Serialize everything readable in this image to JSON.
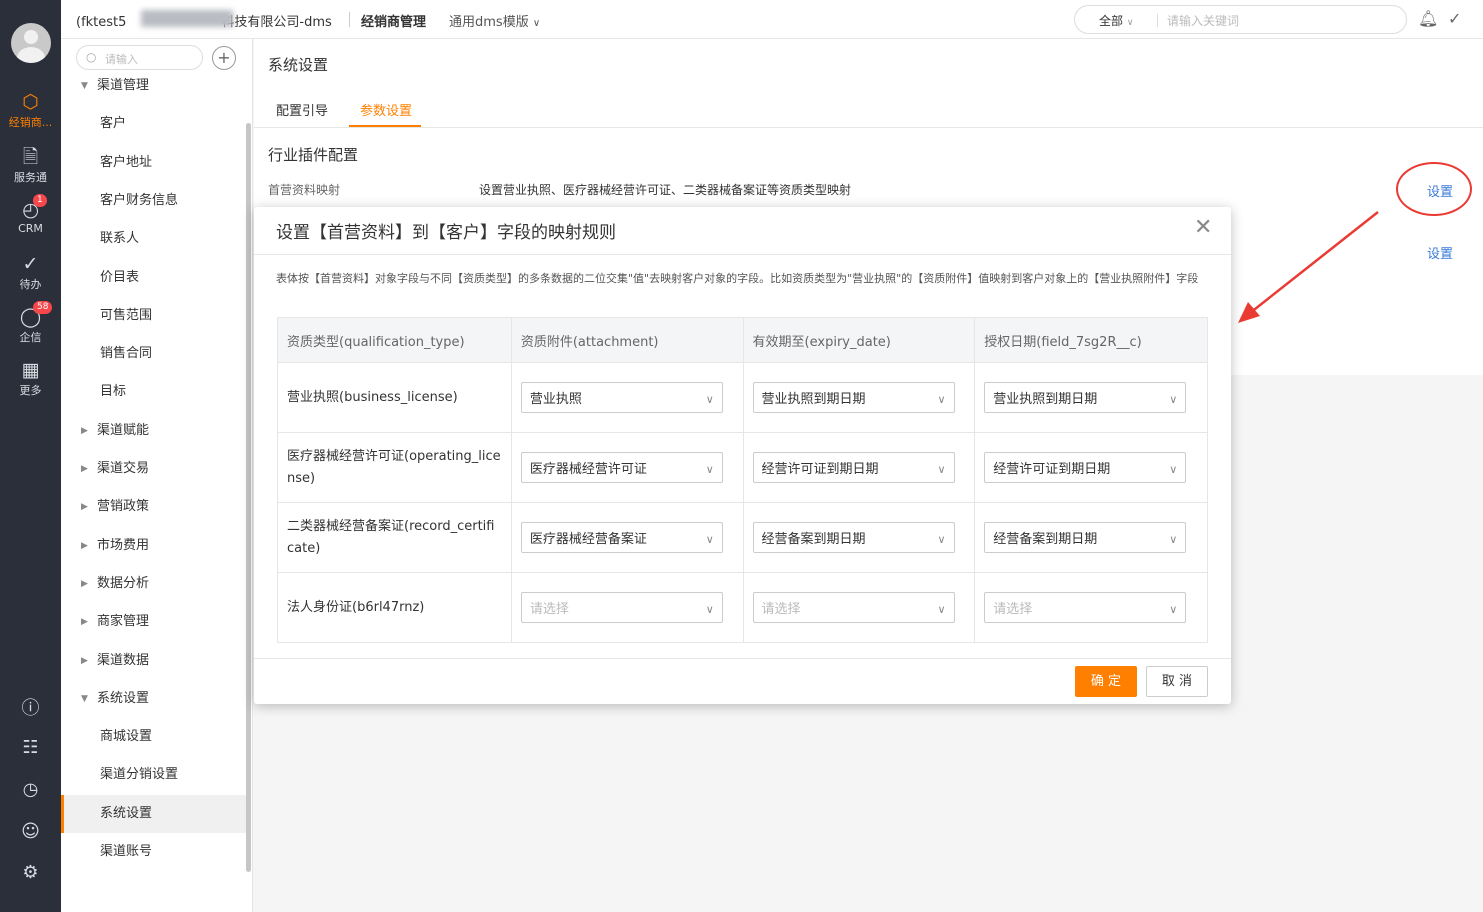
{
  "rail": {
    "items": [
      {
        "label": "经销商...",
        "icon": "cube-icon"
      },
      {
        "label": "服务通",
        "icon": "service-icon"
      },
      {
        "label": "CRM",
        "icon": "crm-icon",
        "badge": "1"
      },
      {
        "label": "待办",
        "icon": "todo-check-icon"
      },
      {
        "label": "企信",
        "icon": "chat-icon",
        "badge": "58"
      },
      {
        "label": "更多",
        "icon": "grid-icon"
      }
    ]
  },
  "topbar": {
    "company": "(fktest5",
    "company_suffix": "科技有限公司-dms",
    "app_name": "经销商管理",
    "template_name": "通用dms模版",
    "search_scope": "全部",
    "search_placeholder": "请输入关键词"
  },
  "sidebar": {
    "search_placeholder": "请输入",
    "items": [
      {
        "label": "渠道管理",
        "type": "group",
        "expanded": true
      },
      {
        "label": "客户",
        "type": "child"
      },
      {
        "label": "客户地址",
        "type": "child"
      },
      {
        "label": "客户财务信息",
        "type": "child"
      },
      {
        "label": "联系人",
        "type": "child"
      },
      {
        "label": "价目表",
        "type": "child"
      },
      {
        "label": "可售范围",
        "type": "child"
      },
      {
        "label": "销售合同",
        "type": "child"
      },
      {
        "label": "目标",
        "type": "child"
      },
      {
        "label": "渠道赋能",
        "type": "group",
        "expanded": false
      },
      {
        "label": "渠道交易",
        "type": "group",
        "expanded": false
      },
      {
        "label": "营销政策",
        "type": "group",
        "expanded": false
      },
      {
        "label": "市场费用",
        "type": "group",
        "expanded": false
      },
      {
        "label": "数据分析",
        "type": "group",
        "expanded": false
      },
      {
        "label": "商家管理",
        "type": "group",
        "expanded": false
      },
      {
        "label": "渠道数据",
        "type": "group",
        "expanded": false
      },
      {
        "label": "系统设置",
        "type": "group",
        "expanded": true
      },
      {
        "label": "商城设置",
        "type": "child"
      },
      {
        "label": "渠道分销设置",
        "type": "child"
      },
      {
        "label": "系统设置",
        "type": "child",
        "active": true
      },
      {
        "label": "渠道账号",
        "type": "child"
      }
    ]
  },
  "main": {
    "page_title": "系统设置",
    "tabs": [
      {
        "label": "配置引导",
        "active": false
      },
      {
        "label": "参数设置",
        "active": true
      }
    ],
    "section_title": "行业插件配置",
    "row_label": "首营资料映射",
    "row_desc": "设置营业执照、医疗器械经营许可证、二类器械备案证等资质类型映射",
    "setting_link_1": "设置",
    "setting_link_2": "设置"
  },
  "modal": {
    "title": "设置【首营资料】到【客户】字段的映射规则",
    "description": "表体按【首营资料】对象字段与不同【资质类型】的多条数据的二位交集\"值\"去映射客户对象的字段。比如资质类型为\"营业执照\"的【资质附件】值映射到客户对象上的【营业执照附件】字段",
    "columns": [
      "资质类型(qualification_type)",
      "资质附件(attachment)",
      "有效期至(expiry_date)",
      "授权日期(field_7sg2R__c)"
    ],
    "rows": [
      {
        "type": "营业执照(business_license)",
        "attachment": "营业执照",
        "expiry": "营业执照到期日期",
        "auth": "营业执照到期日期",
        "placeholder": false
      },
      {
        "type": "医疗器械经营许可证(operating_license)",
        "attachment": "医疗器械经营许可证",
        "expiry": "经营许可证到期日期",
        "auth": "经营许可证到期日期",
        "placeholder": false
      },
      {
        "type": "二类器械经营备案证(record_certificate)",
        "attachment": "医疗器械经营备案证",
        "expiry": "经营备案到期日期",
        "auth": "经营备案到期日期",
        "placeholder": false
      },
      {
        "type": "法人身份证(b6rl47rnz)",
        "attachment": "请选择",
        "expiry": "请选择",
        "auth": "请选择",
        "placeholder": true
      }
    ],
    "ok_label": "确 定",
    "cancel_label": "取 消"
  },
  "colors": {
    "accent": "#ff8000",
    "link": "#3a7ad8",
    "annotation": "#ea3a34",
    "rail_bg": "#2a2f3a"
  }
}
